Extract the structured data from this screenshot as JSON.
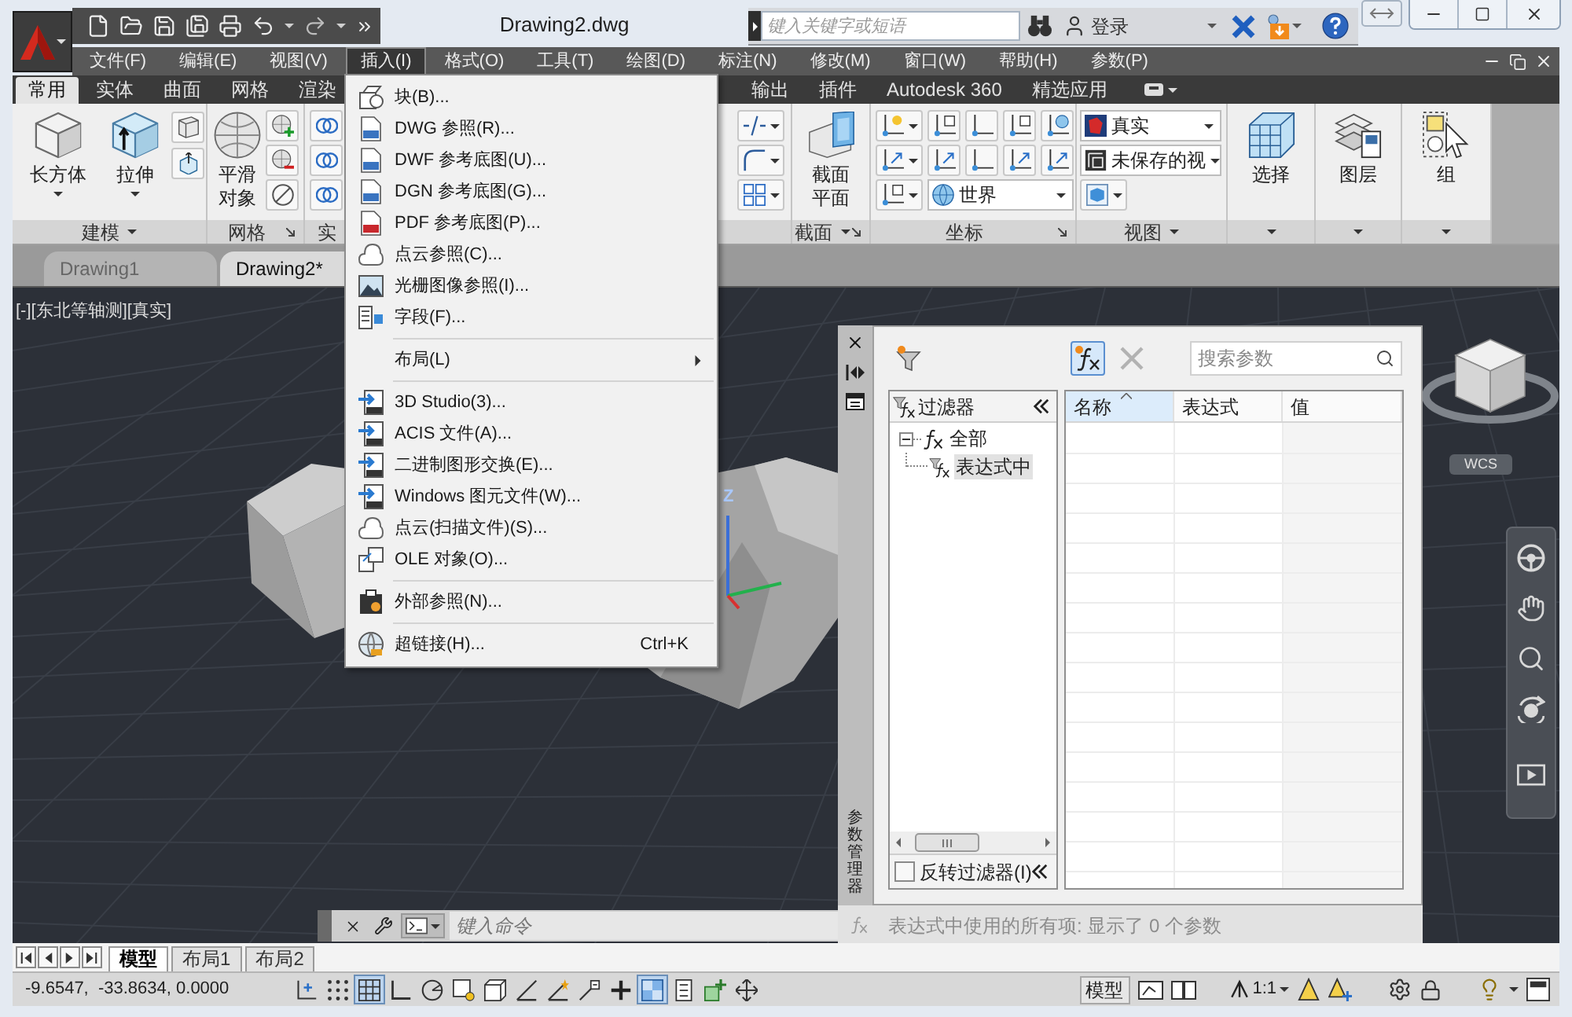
{
  "title_bar": {
    "title": "Drawing2.dwg",
    "search": {
      "placeholder": "键入关键字或短语"
    },
    "sign_in": "登录"
  },
  "menu_bar": {
    "items": [
      {
        "label": "文件(F)",
        "selected": false
      },
      {
        "label": "编辑(E)",
        "selected": false
      },
      {
        "label": "视图(V)",
        "selected": false
      },
      {
        "label": "插入(I)",
        "selected": true
      },
      {
        "label": "格式(O)",
        "selected": false
      },
      {
        "label": "工具(T)",
        "selected": false
      },
      {
        "label": "绘图(D)",
        "selected": false
      },
      {
        "label": "标注(N)",
        "selected": false
      },
      {
        "label": "修改(M)",
        "selected": false
      },
      {
        "label": "窗口(W)",
        "selected": false
      },
      {
        "label": "帮助(H)",
        "selected": false
      },
      {
        "label": "参数(P)",
        "selected": false
      }
    ]
  },
  "ribbon": {
    "tabs": [
      {
        "label": "常用",
        "selected": true
      },
      {
        "label": "实体",
        "selected": false
      },
      {
        "label": "曲面",
        "selected": false
      },
      {
        "label": "网格",
        "selected": false
      },
      {
        "label": "渲染",
        "selected": false
      },
      {
        "label": "输出",
        "selected": false
      },
      {
        "label": "插件",
        "selected": false
      },
      {
        "label": "Autodesk 360",
        "selected": false
      },
      {
        "label": "精选应用",
        "selected": false
      }
    ],
    "panels": [
      {
        "title": "建模",
        "dropdown": true,
        "buttons": [
          {
            "label": "长方体",
            "menu": true
          },
          {
            "label": "拉伸",
            "menu": true
          }
        ]
      },
      {
        "title": "网格",
        "launcher": true,
        "buttons": [
          {
            "label": "平滑对象"
          }
        ]
      },
      {
        "title": "实"
      },
      {
        "title": "截面",
        "dropdown": true,
        "launcher": true,
        "buttons": [
          {
            "label": "截面平面"
          }
        ]
      },
      {
        "title": "坐标",
        "launcher": true,
        "selects": [
          {
            "value": "世界"
          }
        ]
      },
      {
        "title": "视图",
        "dropdown": true,
        "selects": [
          {
            "value": "真实"
          },
          {
            "value": "未保存的视"
          }
        ]
      },
      {
        "dropdown": true,
        "buttons": [
          {
            "label": "选择"
          }
        ]
      },
      {
        "dropdown": true,
        "buttons": [
          {
            "label": "图层"
          }
        ]
      },
      {
        "dropdown": true,
        "buttons": [
          {
            "label": "组"
          }
        ]
      }
    ]
  },
  "document_tabs": [
    {
      "label": "Drawing1",
      "selected": false
    },
    {
      "label": "Drawing2*",
      "selected": true
    }
  ],
  "viewport": {
    "controls": [
      "[-]",
      "[东北等轴测]",
      "[真实]"
    ],
    "ucs_label": "Z",
    "viewcube": {
      "coordinate_system": "WCS"
    }
  },
  "insert_menu": {
    "items": [
      {
        "kind": "item",
        "label": "块(B)..."
      },
      {
        "kind": "item",
        "label": "DWG 参照(R)..."
      },
      {
        "kind": "item",
        "label": "DWF 参考底图(U)..."
      },
      {
        "kind": "item",
        "label": "DGN 参考底图(G)..."
      },
      {
        "kind": "item",
        "label": "PDF 参考底图(P)..."
      },
      {
        "kind": "item",
        "label": "点云参照(C)..."
      },
      {
        "kind": "item",
        "label": "光栅图像参照(I)..."
      },
      {
        "kind": "item",
        "label": "字段(F)..."
      },
      {
        "kind": "separator"
      },
      {
        "kind": "submenu",
        "label": "布局(L)"
      },
      {
        "kind": "separator"
      },
      {
        "kind": "item",
        "label": "3D Studio(3)..."
      },
      {
        "kind": "item",
        "label": "ACIS 文件(A)..."
      },
      {
        "kind": "item",
        "label": "二进制图形交换(E)..."
      },
      {
        "kind": "item",
        "label": "Windows 图元文件(W)..."
      },
      {
        "kind": "item",
        "label": "点云(扫描文件)(S)..."
      },
      {
        "kind": "item",
        "label": "OLE 对象(O)..."
      },
      {
        "kind": "separator"
      },
      {
        "kind": "item",
        "label": "外部参照(N)..."
      },
      {
        "kind": "separator"
      },
      {
        "kind": "item",
        "label": "超链接(H)...",
        "shortcut": "Ctrl+K"
      }
    ]
  },
  "parameters_manager": {
    "title": "参数管理器",
    "toolbar": [
      {
        "kind": "filter",
        "pressed": false,
        "disabled": false
      },
      {
        "kind": "parameter",
        "pressed": true,
        "disabled": false
      },
      {
        "kind": "delete",
        "pressed": false,
        "disabled": true
      }
    ],
    "search": {
      "placeholder": "搜索参数"
    },
    "filter_pane": {
      "header": "过滤器",
      "tree": [
        {
          "label": "全部",
          "selected": false,
          "expanded": true,
          "children": [
            {
              "label": "表达式中",
              "selected": true
            }
          ]
        }
      ],
      "invert_filter": {
        "label": "反转过滤器(I)",
        "checked": false
      }
    },
    "table": {
      "columns": [
        {
          "label": "名称",
          "sorted": true
        },
        {
          "label": "表达式",
          "sorted": false
        },
        {
          "label": "值",
          "sorted": false
        }
      ]
    },
    "status": "表达式中使用的所有项: 显示了 0 个参数"
  },
  "command_line": {
    "placeholder": "键入命令"
  },
  "layout_tabs": [
    {
      "label": "模型",
      "selected": true
    },
    {
      "label": "布局1",
      "selected": false
    },
    {
      "label": "布局2",
      "selected": false
    }
  ],
  "status_bar": {
    "coordinates": "-9.6547,  -33.8634, 0.0000",
    "toggles": [
      {
        "on": false
      },
      {
        "on": false
      },
      {
        "on": true
      },
      {
        "on": false
      },
      {
        "on": false
      },
      {
        "on": false
      },
      {
        "on": false
      },
      {
        "on": false
      },
      {
        "on": false
      },
      {
        "on": false
      },
      {
        "on": false
      },
      {
        "on": true
      },
      {
        "on": false
      },
      {
        "on": false
      },
      {
        "on": false
      }
    ],
    "space": "模型",
    "annotation_scale": "1:1"
  }
}
